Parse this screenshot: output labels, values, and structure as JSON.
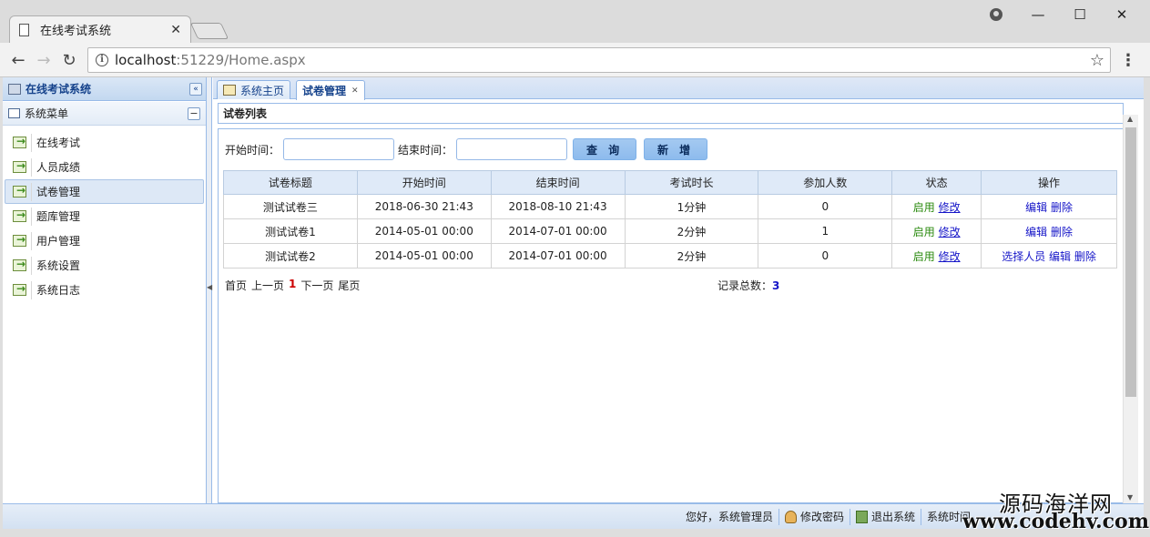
{
  "browser": {
    "tab_title": "在线考试系统",
    "url_host": "localhost",
    "url_path": ":51229/Home.aspx"
  },
  "icons": {
    "doc": "document-icon",
    "profile": "profile-icon",
    "info": "info-icon",
    "star": "star-icon",
    "menu": "vertical-dots-icon",
    "arrow": "green-arrow-icon",
    "home": "home-icon",
    "user": "user-icon",
    "exit": "exit-icon"
  },
  "sidebar": {
    "app_title": "在线考试系统",
    "menu_title": "系统菜单",
    "items": [
      {
        "label": "在线考试"
      },
      {
        "label": "人员成绩"
      },
      {
        "label": "试卷管理"
      },
      {
        "label": "题库管理"
      },
      {
        "label": "用户管理"
      },
      {
        "label": "系统设置"
      },
      {
        "label": "系统日志"
      }
    ]
  },
  "tabs": [
    {
      "label": "系统主页"
    },
    {
      "label": "试卷管理"
    }
  ],
  "panel": {
    "title": "试卷列表"
  },
  "search": {
    "start_label": "开始时间：",
    "end_label": "结束时间：",
    "query_button": "查 询",
    "add_button": "新 增"
  },
  "table": {
    "headers": [
      "试卷标题",
      "开始时间",
      "结束时间",
      "考试时长",
      "参加人数",
      "状态",
      "操作"
    ],
    "rows": [
      {
        "title": "测试试卷三",
        "start": "2018-06-30 21:43",
        "end": "2018-08-10 21:43",
        "duration": "1分钟",
        "count": "0",
        "status": "启用",
        "modify": "修改",
        "ops": [
          "编辑",
          "删除"
        ]
      },
      {
        "title": "测试试卷1",
        "start": "2014-05-01 00:00",
        "end": "2014-07-01 00:00",
        "duration": "2分钟",
        "count": "1",
        "status": "启用",
        "modify": "修改",
        "ops": [
          "编辑",
          "删除"
        ]
      },
      {
        "title": "测试试卷2",
        "start": "2014-05-01 00:00",
        "end": "2014-07-01 00:00",
        "duration": "2分钟",
        "count": "0",
        "status": "启用",
        "modify": "修改",
        "ops": [
          "选择人员",
          "编辑",
          "删除"
        ]
      }
    ]
  },
  "pager": {
    "first": "首页",
    "prev": "上一页",
    "current": "1",
    "next": "下一页",
    "last": "尾页",
    "total_label": "记录总数：",
    "total_value": "3"
  },
  "statusbar": {
    "greeting": "您好，系统管理员",
    "change_password": "修改密码",
    "logout": "退出系统",
    "time_label": "系统时间"
  },
  "watermark": {
    "cn": "源码海洋网",
    "url": "www.codehy.com"
  }
}
